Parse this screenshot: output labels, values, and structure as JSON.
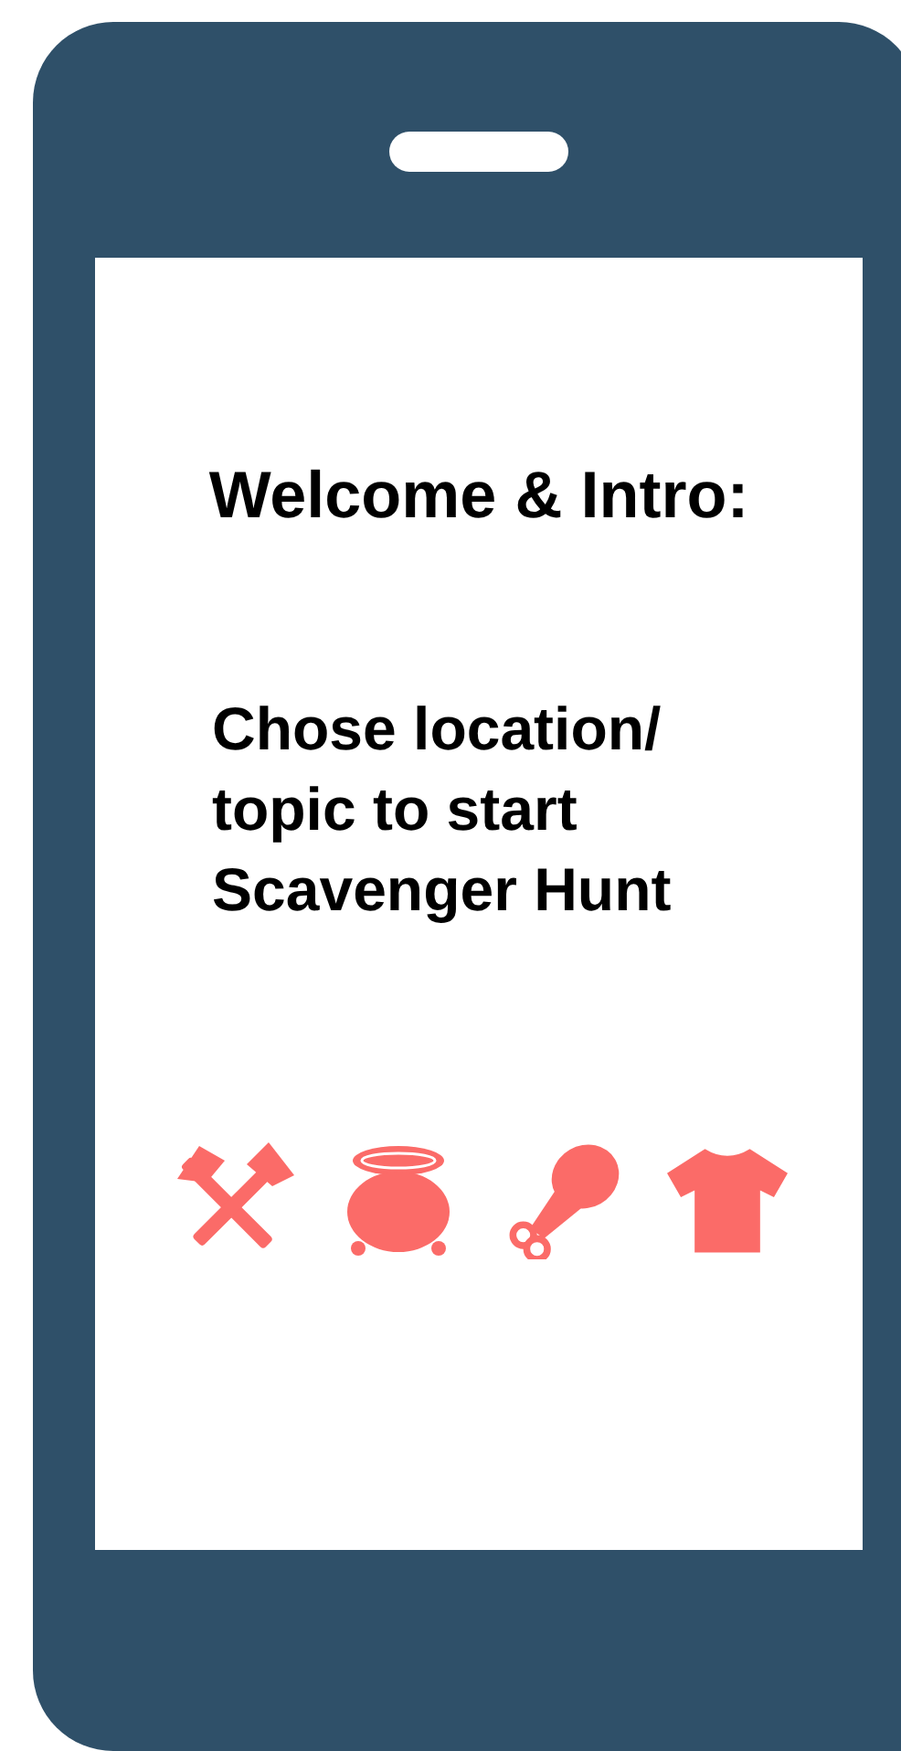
{
  "screen": {
    "title": "Welcome & Intro:",
    "body_lines": [
      "Chose location/",
      "topic to start",
      "Scavenger Hunt"
    ]
  }
}
